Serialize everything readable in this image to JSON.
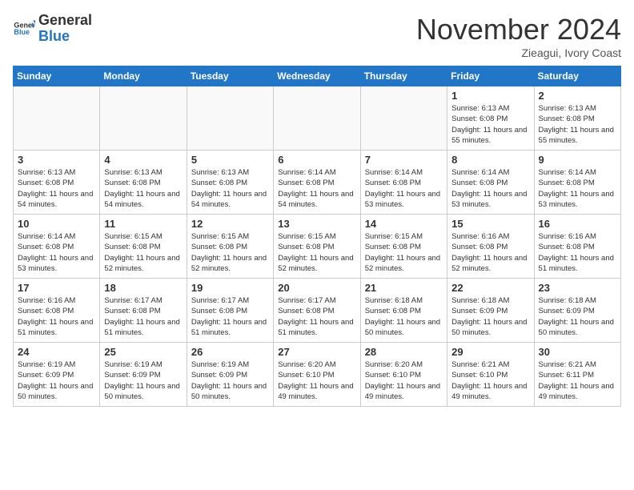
{
  "header": {
    "logo_general": "General",
    "logo_blue": "Blue",
    "month_title": "November 2024",
    "location": "Zieagui, Ivory Coast"
  },
  "calendar": {
    "days_of_week": [
      "Sunday",
      "Monday",
      "Tuesday",
      "Wednesday",
      "Thursday",
      "Friday",
      "Saturday"
    ],
    "weeks": [
      [
        {
          "day": "",
          "empty": true
        },
        {
          "day": "",
          "empty": true
        },
        {
          "day": "",
          "empty": true
        },
        {
          "day": "",
          "empty": true
        },
        {
          "day": "",
          "empty": true
        },
        {
          "day": "1",
          "sunrise": "6:13 AM",
          "sunset": "6:08 PM",
          "daylight": "11 hours and 55 minutes."
        },
        {
          "day": "2",
          "sunrise": "6:13 AM",
          "sunset": "6:08 PM",
          "daylight": "11 hours and 55 minutes."
        }
      ],
      [
        {
          "day": "3",
          "sunrise": "6:13 AM",
          "sunset": "6:08 PM",
          "daylight": "11 hours and 54 minutes."
        },
        {
          "day": "4",
          "sunrise": "6:13 AM",
          "sunset": "6:08 PM",
          "daylight": "11 hours and 54 minutes."
        },
        {
          "day": "5",
          "sunrise": "6:13 AM",
          "sunset": "6:08 PM",
          "daylight": "11 hours and 54 minutes."
        },
        {
          "day": "6",
          "sunrise": "6:14 AM",
          "sunset": "6:08 PM",
          "daylight": "11 hours and 54 minutes."
        },
        {
          "day": "7",
          "sunrise": "6:14 AM",
          "sunset": "6:08 PM",
          "daylight": "11 hours and 53 minutes."
        },
        {
          "day": "8",
          "sunrise": "6:14 AM",
          "sunset": "6:08 PM",
          "daylight": "11 hours and 53 minutes."
        },
        {
          "day": "9",
          "sunrise": "6:14 AM",
          "sunset": "6:08 PM",
          "daylight": "11 hours and 53 minutes."
        }
      ],
      [
        {
          "day": "10",
          "sunrise": "6:14 AM",
          "sunset": "6:08 PM",
          "daylight": "11 hours and 53 minutes."
        },
        {
          "day": "11",
          "sunrise": "6:15 AM",
          "sunset": "6:08 PM",
          "daylight": "11 hours and 52 minutes."
        },
        {
          "day": "12",
          "sunrise": "6:15 AM",
          "sunset": "6:08 PM",
          "daylight": "11 hours and 52 minutes."
        },
        {
          "day": "13",
          "sunrise": "6:15 AM",
          "sunset": "6:08 PM",
          "daylight": "11 hours and 52 minutes."
        },
        {
          "day": "14",
          "sunrise": "6:15 AM",
          "sunset": "6:08 PM",
          "daylight": "11 hours and 52 minutes."
        },
        {
          "day": "15",
          "sunrise": "6:16 AM",
          "sunset": "6:08 PM",
          "daylight": "11 hours and 52 minutes."
        },
        {
          "day": "16",
          "sunrise": "6:16 AM",
          "sunset": "6:08 PM",
          "daylight": "11 hours and 51 minutes."
        }
      ],
      [
        {
          "day": "17",
          "sunrise": "6:16 AM",
          "sunset": "6:08 PM",
          "daylight": "11 hours and 51 minutes."
        },
        {
          "day": "18",
          "sunrise": "6:17 AM",
          "sunset": "6:08 PM",
          "daylight": "11 hours and 51 minutes."
        },
        {
          "day": "19",
          "sunrise": "6:17 AM",
          "sunset": "6:08 PM",
          "daylight": "11 hours and 51 minutes."
        },
        {
          "day": "20",
          "sunrise": "6:17 AM",
          "sunset": "6:08 PM",
          "daylight": "11 hours and 51 minutes."
        },
        {
          "day": "21",
          "sunrise": "6:18 AM",
          "sunset": "6:08 PM",
          "daylight": "11 hours and 50 minutes."
        },
        {
          "day": "22",
          "sunrise": "6:18 AM",
          "sunset": "6:09 PM",
          "daylight": "11 hours and 50 minutes."
        },
        {
          "day": "23",
          "sunrise": "6:18 AM",
          "sunset": "6:09 PM",
          "daylight": "11 hours and 50 minutes."
        }
      ],
      [
        {
          "day": "24",
          "sunrise": "6:19 AM",
          "sunset": "6:09 PM",
          "daylight": "11 hours and 50 minutes."
        },
        {
          "day": "25",
          "sunrise": "6:19 AM",
          "sunset": "6:09 PM",
          "daylight": "11 hours and 50 minutes."
        },
        {
          "day": "26",
          "sunrise": "6:19 AM",
          "sunset": "6:09 PM",
          "daylight": "11 hours and 50 minutes."
        },
        {
          "day": "27",
          "sunrise": "6:20 AM",
          "sunset": "6:10 PM",
          "daylight": "11 hours and 49 minutes."
        },
        {
          "day": "28",
          "sunrise": "6:20 AM",
          "sunset": "6:10 PM",
          "daylight": "11 hours and 49 minutes."
        },
        {
          "day": "29",
          "sunrise": "6:21 AM",
          "sunset": "6:10 PM",
          "daylight": "11 hours and 49 minutes."
        },
        {
          "day": "30",
          "sunrise": "6:21 AM",
          "sunset": "6:11 PM",
          "daylight": "11 hours and 49 minutes."
        }
      ]
    ]
  }
}
